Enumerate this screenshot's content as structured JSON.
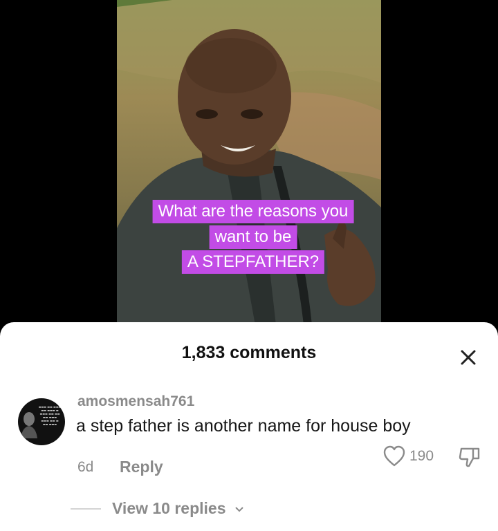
{
  "video": {
    "caption_lines": [
      "What are the reasons you",
      "want to be",
      "A STEPFATHER?"
    ],
    "caption_bg": "#c24ce6"
  },
  "comments_sheet": {
    "title": "1,833 comments",
    "close_icon": "close-icon",
    "comments": [
      {
        "username": "amosmensah761",
        "text": "a step father is another name for house boy",
        "age": "6d",
        "reply_label": "Reply",
        "like_count": "190",
        "view_replies_label": "View 10 replies"
      }
    ]
  },
  "colors": {
    "muted_text": "#8a8a8a",
    "primary_text": "#161616",
    "sheet_bg": "#ffffff"
  }
}
